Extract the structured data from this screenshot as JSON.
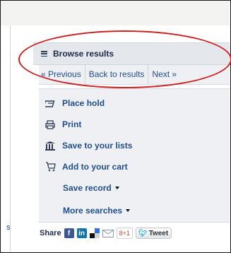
{
  "browse": {
    "title": "Browse results",
    "previous": "« Previous",
    "back": "Back to results",
    "next": "Next »"
  },
  "actions": {
    "place_hold": "Place hold",
    "print": "Print",
    "save_lists": "Save to your lists",
    "add_cart": "Add to your cart",
    "save_record": "Save record",
    "more_searches": "More searches"
  },
  "share": {
    "label": "Share",
    "gplus": "8+1",
    "tweet": "Tweet"
  },
  "left_fragment": "s",
  "colors": {
    "link": "#1f4e8c",
    "header_bg": "#e4e7ec",
    "panel_bg": "#eef0f3",
    "annotation": "#cc1f1f"
  }
}
